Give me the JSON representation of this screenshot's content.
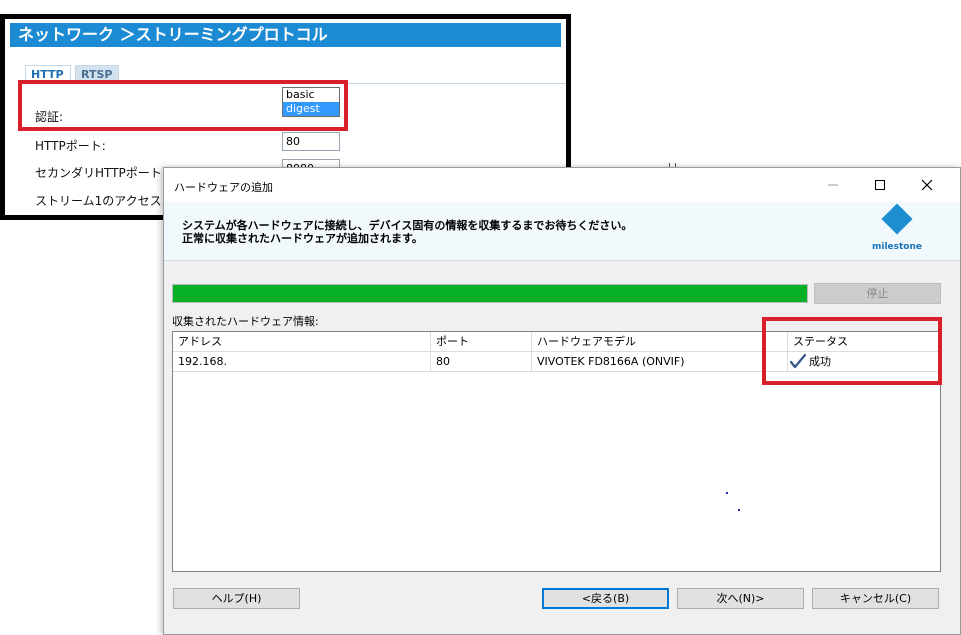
{
  "camera_ui": {
    "title": "ネットワーク ＞ストリーミングプロトコル",
    "tabs": [
      {
        "label": "HTTP"
      },
      {
        "label": "RTSP"
      }
    ],
    "auth_label": "認証:",
    "auth_options": [
      "basic",
      "digest"
    ],
    "auth_selected": "digest",
    "http_port_label": "HTTPポート:",
    "http_port_value": "80",
    "secondary_port_label": "セカンダリHTTPポート",
    "secondary_port_value": "8080",
    "stream_label": "ストリーム1のアクセス"
  },
  "dialog": {
    "title": "ハードウェアの追加",
    "header_line1": "システムが各ハードウェアに接続し、デバイス固有の情報を収集するまでお待ちください。",
    "header_line2": "正常に収集されたハードウェアが追加されます。",
    "logo_text": "milestone",
    "progress_fraction": 1.0,
    "stop_label": "停止",
    "section_label": "収集されたハードウェア情報:",
    "table": {
      "columns": [
        "アドレス",
        "ポート",
        "ハードウェアモデル",
        "ステータス"
      ],
      "rows": [
        {
          "address": "192.168.",
          "port": "80",
          "model": "VIVOTEK FD8166A (ONVIF)",
          "status": "成功"
        }
      ]
    },
    "buttons": {
      "help": "ヘルプ(H)",
      "back": "<戻る(B)",
      "next": "次へ(N)>",
      "cancel": "キャンセル(C)"
    }
  },
  "colors": {
    "camera_title_bg": "#1d8bd3",
    "progress_fill": "#06b025",
    "highlight_red": "#d9202a",
    "milestone_blue": "#1d8fd0"
  }
}
